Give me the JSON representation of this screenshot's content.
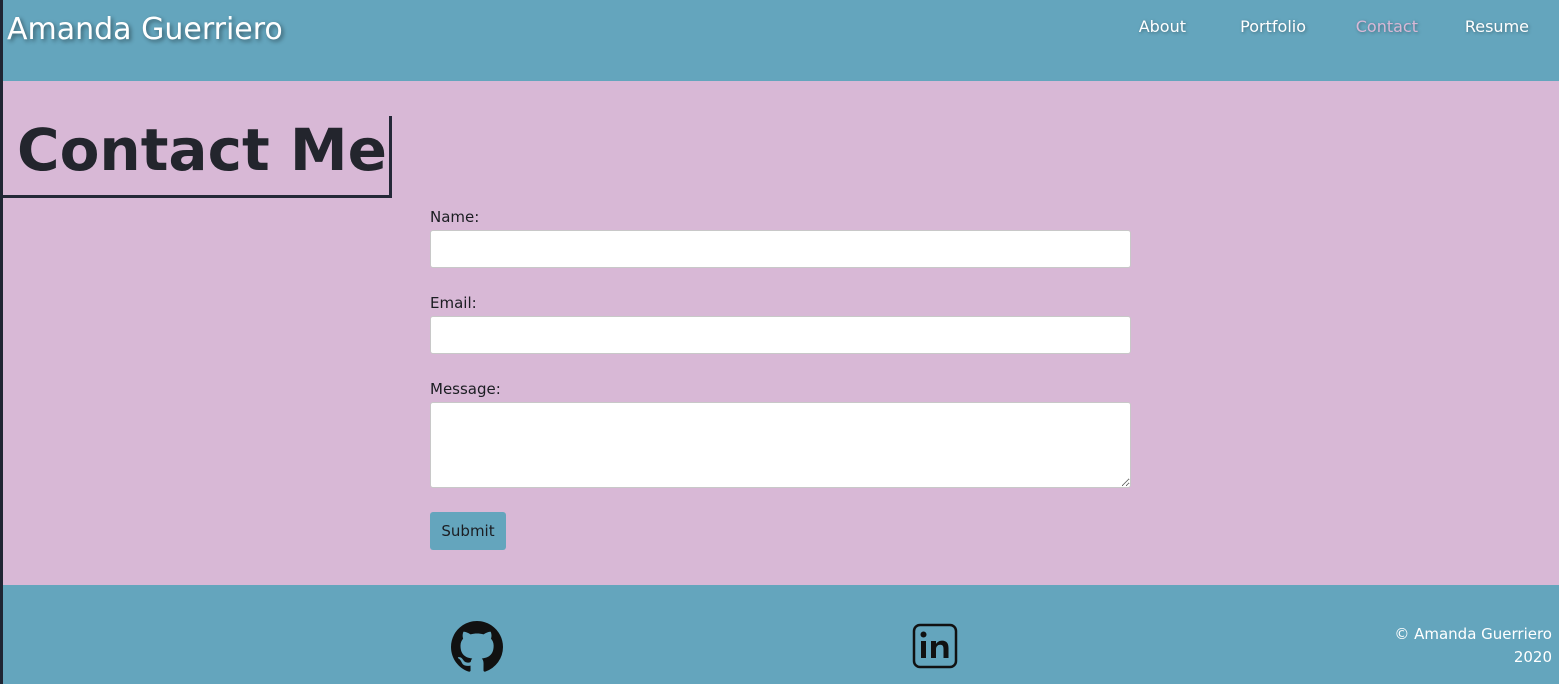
{
  "header": {
    "site_title": "Amanda Guerriero",
    "nav": [
      {
        "label": "About",
        "active": false
      },
      {
        "label": "Portfolio",
        "active": false
      },
      {
        "label": "Contact",
        "active": true
      },
      {
        "label": "Resume",
        "active": false
      }
    ]
  },
  "main": {
    "page_title": "Contact Me",
    "form": {
      "name_label": "Name:",
      "name_value": "",
      "email_label": "Email:",
      "email_value": "",
      "message_label": "Message:",
      "message_value": "",
      "submit_label": "Submit"
    }
  },
  "footer": {
    "icons": [
      "github-icon",
      "linkedin-icon"
    ],
    "copyright_line1": "© Amanda Guerriero",
    "copyright_line2": "2020"
  },
  "colors": {
    "header_bg": "#64a5bd",
    "page_bg": "#d8b8d6",
    "active_nav": "#d8b8d6",
    "text_dark": "#23252d"
  }
}
